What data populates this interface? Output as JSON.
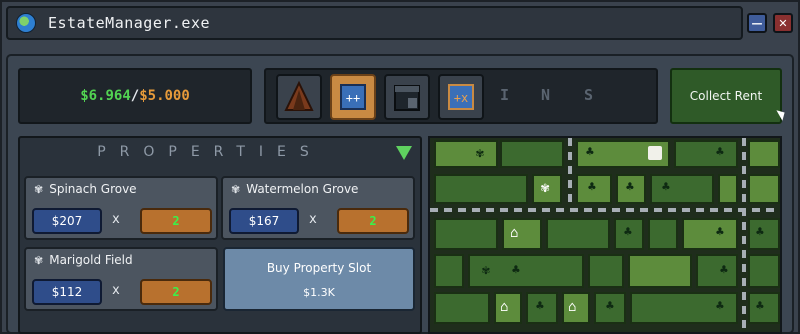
{
  "window": {
    "title": "EstateManager.exe",
    "minimize_label": "—",
    "close_label": "✕"
  },
  "money": {
    "current": "$6.964",
    "separator": "/",
    "target": "$5.000"
  },
  "toolbar": {
    "letters": [
      "I",
      "N",
      "S"
    ]
  },
  "collect_button": {
    "label": "Collect Rent"
  },
  "properties": {
    "heading": "PROPERTIES",
    "items": [
      {
        "name": "Spinach Grove",
        "price": "$207",
        "times": "x",
        "quantity": "2"
      },
      {
        "name": "Watermelon Grove",
        "price": "$167",
        "times": "x",
        "quantity": "2"
      },
      {
        "name": "Marigold Field",
        "price": "$112",
        "times": "x",
        "quantity": "2"
      }
    ],
    "buy_slot": {
      "label": "Buy Property Slot",
      "price": "$1.3K"
    }
  },
  "icons": {
    "app": "globe-icon",
    "filter": "filter-triangle-icon",
    "property": "wheat-icon",
    "tools": [
      "tent-icon",
      "plus-plus-icon",
      "building-icon",
      "plus-multiply-icon"
    ]
  },
  "colors": {
    "money_current": "#52d452",
    "money_target": "#e69a3a",
    "collect": "#2f5a28",
    "price": "#2f4d8a",
    "quantity": "#b8712e"
  }
}
